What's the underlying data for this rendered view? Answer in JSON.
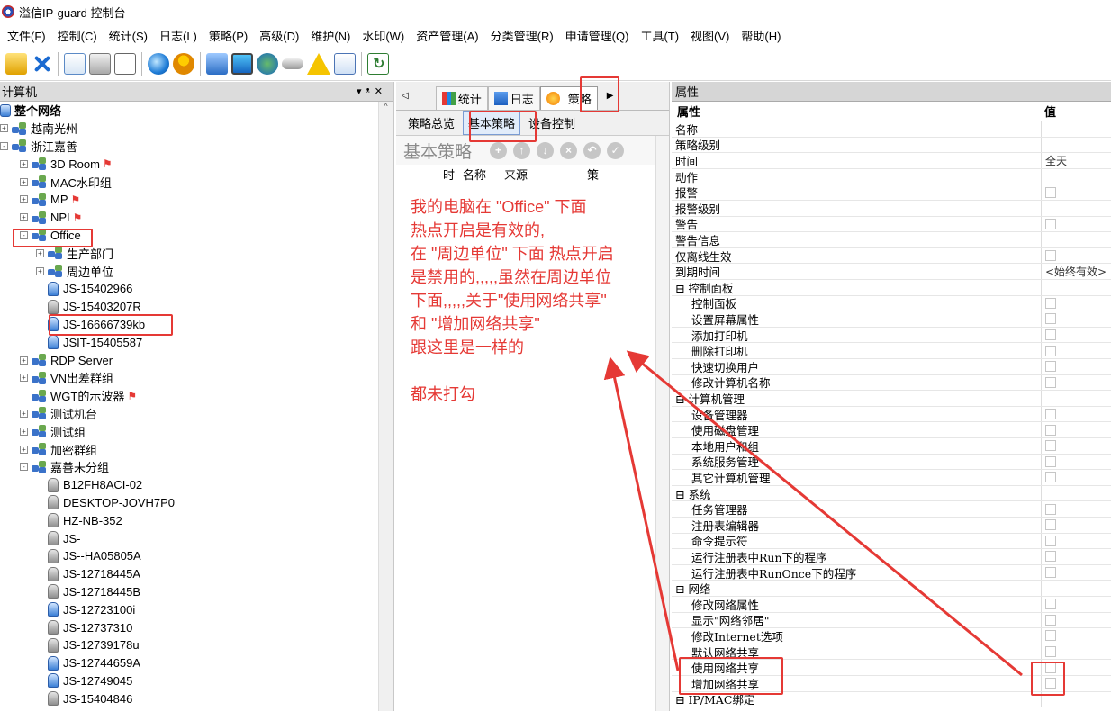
{
  "window": {
    "title": "溢信IP-guard 控制台"
  },
  "menu": [
    "文件(F)",
    "控制(C)",
    "统计(S)",
    "日志(L)",
    "策略(P)",
    "高级(D)",
    "维护(N)",
    "水印(W)",
    "资产管理(A)",
    "分类管理(R)",
    "申请管理(Q)",
    "工具(T)",
    "视图(V)",
    "帮助(H)"
  ],
  "toolbar_icons": [
    "open-icon",
    "delete-icon",
    "export-icon",
    "print-icon",
    "print-preview-icon",
    "globe-icon",
    "user-icon",
    "network-icon",
    "monitor-icon",
    "world-icon",
    "disk-icon",
    "warning-icon",
    "edit-icon",
    "refresh-icon"
  ],
  "left": {
    "header": "计算机",
    "tree": [
      {
        "label": "整个网络",
        "indent": 0,
        "icon": "root",
        "exp": "",
        "bold": true
      },
      {
        "label": "越南光州",
        "indent": 1,
        "icon": "net",
        "exp": "+"
      },
      {
        "label": "浙江嘉善",
        "indent": 1,
        "icon": "net",
        "exp": "-"
      },
      {
        "label": "3D Room",
        "indent": 2,
        "icon": "net",
        "exp": "+",
        "flag": true
      },
      {
        "label": "MAC水印组",
        "indent": 2,
        "icon": "net",
        "exp": "+"
      },
      {
        "label": "MP",
        "indent": 2,
        "icon": "net",
        "exp": "+",
        "flag": true
      },
      {
        "label": "NPI",
        "indent": 2,
        "icon": "net",
        "exp": "+",
        "flag": true
      },
      {
        "label": "Office",
        "indent": 2,
        "icon": "net",
        "exp": "-"
      },
      {
        "label": "生产部门",
        "indent": 3,
        "icon": "net",
        "exp": "+"
      },
      {
        "label": "周边单位",
        "indent": 3,
        "icon": "net",
        "exp": "+"
      },
      {
        "label": "JS-15402966",
        "indent": 3,
        "icon": "pc-blue",
        "exp": ""
      },
      {
        "label": "JS-15403207R",
        "indent": 3,
        "icon": "pc",
        "exp": ""
      },
      {
        "label": "JS-16666739kb",
        "indent": 3,
        "icon": "pc-blue",
        "exp": ""
      },
      {
        "label": "JSIT-15405587",
        "indent": 3,
        "icon": "pc-blue",
        "exp": ""
      },
      {
        "label": "RDP Server",
        "indent": 2,
        "icon": "net",
        "exp": "+"
      },
      {
        "label": "VN出差群组",
        "indent": 2,
        "icon": "net",
        "exp": "+"
      },
      {
        "label": "WGT的示波器",
        "indent": 2,
        "icon": "net",
        "exp": "",
        "flag": true
      },
      {
        "label": "测试机台",
        "indent": 2,
        "icon": "net",
        "exp": "+"
      },
      {
        "label": "测试组",
        "indent": 2,
        "icon": "net",
        "exp": "+"
      },
      {
        "label": "加密群组",
        "indent": 2,
        "icon": "net",
        "exp": "+"
      },
      {
        "label": "嘉善未分组",
        "indent": 2,
        "icon": "net",
        "exp": "-"
      },
      {
        "label": "B12FH8ACI-02",
        "indent": 3,
        "icon": "pc",
        "exp": ""
      },
      {
        "label": "DESKTOP-JOVH7P0",
        "indent": 3,
        "icon": "pc",
        "exp": ""
      },
      {
        "label": "HZ-NB-352",
        "indent": 3,
        "icon": "pc",
        "exp": ""
      },
      {
        "label": "JS-",
        "indent": 3,
        "icon": "pc",
        "exp": ""
      },
      {
        "label": "JS--HA05805A",
        "indent": 3,
        "icon": "pc",
        "exp": ""
      },
      {
        "label": "JS-12718445A",
        "indent": 3,
        "icon": "pc",
        "exp": ""
      },
      {
        "label": "JS-12718445B",
        "indent": 3,
        "icon": "pc",
        "exp": ""
      },
      {
        "label": "JS-12723100i",
        "indent": 3,
        "icon": "pc-blue",
        "exp": ""
      },
      {
        "label": "JS-12737310",
        "indent": 3,
        "icon": "pc",
        "exp": ""
      },
      {
        "label": "JS-12739178u",
        "indent": 3,
        "icon": "pc",
        "exp": ""
      },
      {
        "label": "JS-12744659A",
        "indent": 3,
        "icon": "pc-blue",
        "exp": ""
      },
      {
        "label": "JS-12749045",
        "indent": 3,
        "icon": "pc-blue",
        "exp": ""
      },
      {
        "label": "JS-15404846",
        "indent": 3,
        "icon": "pc",
        "exp": ""
      }
    ]
  },
  "mid": {
    "tabs": [
      "统计",
      "日志",
      "策略"
    ],
    "subtabs": [
      "策略总览",
      "基本策略",
      "设备控制"
    ],
    "section_title": "基本策略",
    "columns": [
      "时",
      "名称",
      "来源",
      "策"
    ],
    "annotation": [
      "我的电脑在 \"Office\" 下面",
      "  热点开启是有效的,",
      "在 \"周边单位\" 下面 热点开启",
      "是禁用的,,,,,虽然在周边单位",
      "下面,,,,,关于\"使用网络共享\"",
      " 和 \"增加网络共享\"",
      "  跟这里是一样的",
      "",
      "   都未打勾"
    ]
  },
  "right": {
    "header": "属性",
    "col_name": "属性",
    "col_value": "值",
    "rows": [
      {
        "name": "名称",
        "sub": false,
        "value": "",
        "check": false
      },
      {
        "name": "策略级别",
        "sub": false,
        "value": "",
        "check": false
      },
      {
        "name": "时间",
        "sub": false,
        "value": "全天",
        "check": false
      },
      {
        "name": "动作",
        "sub": false,
        "value": "",
        "check": false
      },
      {
        "name": "报警",
        "sub": false,
        "value": "",
        "check": true
      },
      {
        "name": "报警级别",
        "sub": false,
        "value": "",
        "check": false
      },
      {
        "name": "警告",
        "sub": false,
        "value": "",
        "check": true
      },
      {
        "name": "警告信息",
        "sub": false,
        "value": "",
        "check": false
      },
      {
        "name": "仅离线生效",
        "sub": false,
        "value": "",
        "check": true
      },
      {
        "name": "到期时间",
        "sub": false,
        "value": "<始终有效>",
        "check": false
      },
      {
        "name": "⊟ 控制面板",
        "sub": false,
        "value": "",
        "check": false
      },
      {
        "name": "控制面板",
        "sub": true,
        "value": "",
        "check": true
      },
      {
        "name": "设置屏幕属性",
        "sub": true,
        "value": "",
        "check": true
      },
      {
        "name": "添加打印机",
        "sub": true,
        "value": "",
        "check": true
      },
      {
        "name": "删除打印机",
        "sub": true,
        "value": "",
        "check": true
      },
      {
        "name": "快速切换用户",
        "sub": true,
        "value": "",
        "check": true
      },
      {
        "name": "修改计算机名称",
        "sub": true,
        "value": "",
        "check": true
      },
      {
        "name": "⊟ 计算机管理",
        "sub": false,
        "value": "",
        "check": false
      },
      {
        "name": "设备管理器",
        "sub": true,
        "value": "",
        "check": true
      },
      {
        "name": "使用磁盘管理",
        "sub": true,
        "value": "",
        "check": true
      },
      {
        "name": "本地用户和组",
        "sub": true,
        "value": "",
        "check": true
      },
      {
        "name": "系统服务管理",
        "sub": true,
        "value": "",
        "check": true
      },
      {
        "name": "其它计算机管理",
        "sub": true,
        "value": "",
        "check": true
      },
      {
        "name": "⊟ 系统",
        "sub": false,
        "value": "",
        "check": false
      },
      {
        "name": "任务管理器",
        "sub": true,
        "value": "",
        "check": true
      },
      {
        "name": "注册表编辑器",
        "sub": true,
        "value": "",
        "check": true
      },
      {
        "name": "命令提示符",
        "sub": true,
        "value": "",
        "check": true
      },
      {
        "name": "运行注册表中Run下的程序",
        "sub": true,
        "value": "",
        "check": true
      },
      {
        "name": "运行注册表中RunOnce下的程序",
        "sub": true,
        "value": "",
        "check": true
      },
      {
        "name": "⊟ 网络",
        "sub": false,
        "value": "",
        "check": false
      },
      {
        "name": "修改网络属性",
        "sub": true,
        "value": "",
        "check": true
      },
      {
        "name": "显示\"网络邻居\"",
        "sub": true,
        "value": "",
        "check": true
      },
      {
        "name": "修改Internet选项",
        "sub": true,
        "value": "",
        "check": true
      },
      {
        "name": "默认网络共享",
        "sub": true,
        "value": "",
        "check": true
      },
      {
        "name": "使用网络共享",
        "sub": true,
        "value": "",
        "check": true
      },
      {
        "name": "增加网络共享",
        "sub": true,
        "value": "",
        "check": true
      },
      {
        "name": "⊟ IP/MAC绑定",
        "sub": false,
        "value": "",
        "check": false
      }
    ]
  }
}
